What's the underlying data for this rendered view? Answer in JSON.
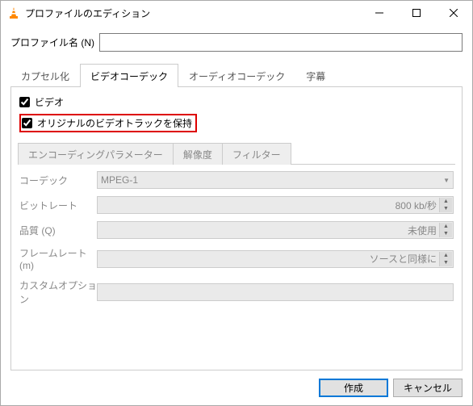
{
  "window": {
    "title": "プロファイルのエディション"
  },
  "profile": {
    "label": "プロファイル名 (N)",
    "value": ""
  },
  "tabs": {
    "encap": "カプセル化",
    "video": "ビデオコーデック",
    "audio": "オーディオコーデック",
    "subs": "字幕"
  },
  "checks": {
    "video": "ビデオ",
    "keepOriginal": "オリジナルのビデオトラックを保持"
  },
  "subtabs": {
    "params": "エンコーディングパラメーター",
    "resolution": "解像度",
    "filters": "フィルター"
  },
  "form": {
    "codec": {
      "label": "コーデック",
      "value": "MPEG-1"
    },
    "bitrate": {
      "label": "ビットレート",
      "value": "800 kb/秒"
    },
    "quality": {
      "label": "品質 (Q)",
      "value": "未使用"
    },
    "framerate": {
      "label": "フレームレート (m)",
      "value": "ソースと同様に"
    },
    "custom": {
      "label": "カスタムオプション",
      "value": ""
    }
  },
  "buttons": {
    "create": "作成",
    "cancel": "キャンセル"
  }
}
